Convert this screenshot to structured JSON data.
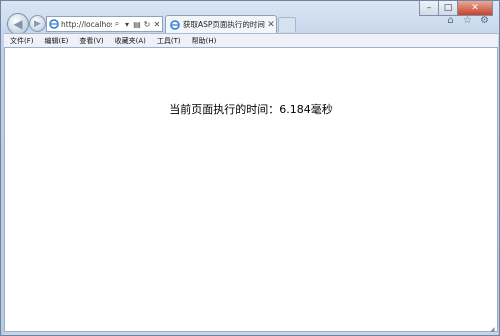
{
  "browser": {
    "address": {
      "url": "http://localhost/"
    },
    "tab": {
      "title": "获取ASP页面执行的时间"
    },
    "menu": [
      "文件(F)",
      "编辑(E)",
      "查看(V)",
      "收藏夹(A)",
      "工具(T)",
      "帮助(H)"
    ]
  },
  "page": {
    "timing_text": "当前页面执行的时间：6.184毫秒"
  },
  "icons": {
    "back": "back-arrow-icon",
    "forward": "forward-arrow-icon",
    "search": "search-icon",
    "refresh": "refresh-icon",
    "stop": "stop-icon",
    "home": "home-icon",
    "favorites": "star-icon",
    "tools": "gear-icon"
  },
  "colors": {
    "chrome": "#c8d8ec",
    "close_button": "#c7432b"
  }
}
